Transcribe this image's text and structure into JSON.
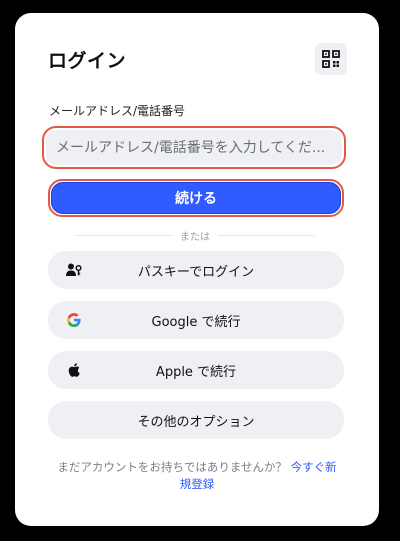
{
  "login": {
    "title": "ログイン",
    "field_label": "メールアドレス/電話番号",
    "input_placeholder": "メールアドレス/電話番号を入力してくだ...",
    "input_value": "",
    "continue_label": "続ける",
    "divider_text": "または",
    "buttons": [
      {
        "label": "パスキーでログイン",
        "icon": "passkey-icon"
      },
      {
        "label": "Google で続行",
        "icon": "google-icon"
      },
      {
        "label": "Apple で続行",
        "icon": "apple-icon"
      },
      {
        "label": "その他のオプション",
        "icon": ""
      }
    ],
    "footer_text": "まだアカウントをお持ちではありませんか？",
    "footer_link": "今すぐ新規登録"
  },
  "colors": {
    "accent": "#2f5bff",
    "focus_ring": "#e05a4a",
    "button_bg": "#eef0f4"
  }
}
